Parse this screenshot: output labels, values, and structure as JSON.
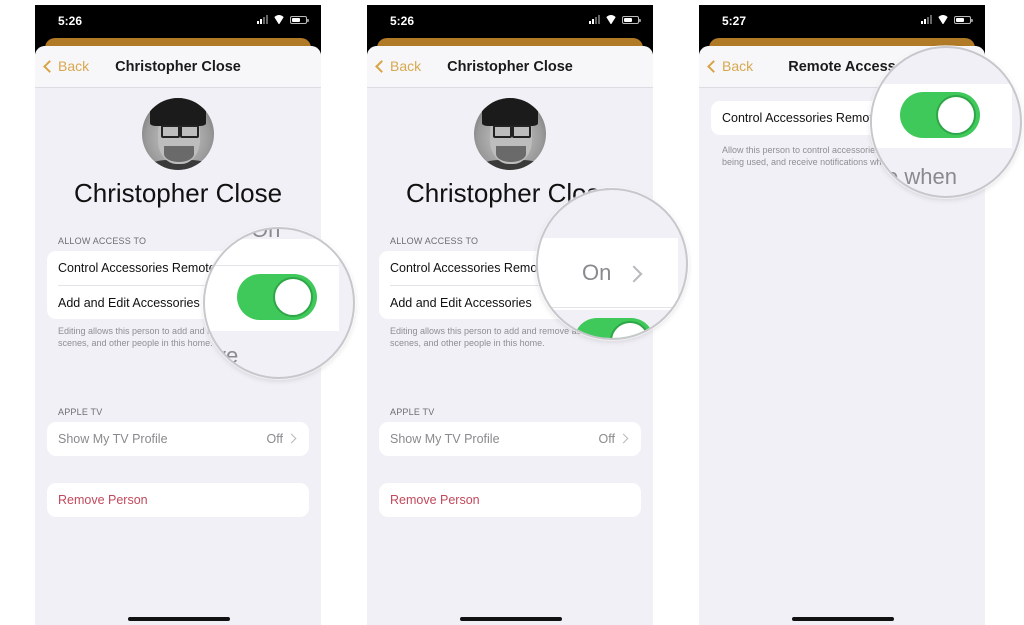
{
  "screens": [
    {
      "status_time": "5:26",
      "back_label": "Back",
      "nav_title": "Christopher Close",
      "person_name": "Christopher Close",
      "allow_access_header": "ALLOW ACCESS TO",
      "rows": [
        {
          "label": "Control Accessories Remotely"
        },
        {
          "label": "Add and Edit Accessories",
          "toggle_on": true
        }
      ],
      "footer": "Editing allows this person to add and remove accessories, scenes, and other people in this home.",
      "apple_tv_header": "APPLE TV",
      "tv_row": {
        "label": "Show My TV Profile",
        "value": "Off"
      },
      "remove_label": "Remove Person",
      "lens": {
        "text_top": "On",
        "text_bottom": "ve",
        "toggle_on": true
      }
    },
    {
      "status_time": "5:26",
      "back_label": "Back",
      "nav_title": "Christopher Close",
      "person_name": "Christopher Close",
      "allow_access_header": "ALLOW ACCESS TO",
      "rows": [
        {
          "label": "Control Accessories Remotely",
          "value": "On"
        },
        {
          "label": "Add and Edit Accessories",
          "toggle_on": true
        }
      ],
      "footer": "Editing allows this person to add and remove accessories, scenes, and other people in this home.",
      "apple_tv_header": "APPLE TV",
      "tv_row": {
        "label": "Show My TV Profile",
        "value": "Off"
      },
      "remove_label": "Remove Person",
      "lens": {
        "value_text": "On"
      }
    },
    {
      "status_time": "5:27",
      "back_label": "Back",
      "nav_title": "Remote Access",
      "rows": [
        {
          "label": "Control Accessories Remotely",
          "toggle_on": true
        }
      ],
      "footer": "Allow this person to control accessories, see when they are being used, and receive notifications when not at home.",
      "lens": {
        "text_bottom": "e when",
        "toggle_on": true
      }
    }
  ],
  "colors": {
    "accent": "#d9a445",
    "toggle_on": "#3fc95a",
    "danger": "#c2485b",
    "background": "#f0f0f6"
  }
}
